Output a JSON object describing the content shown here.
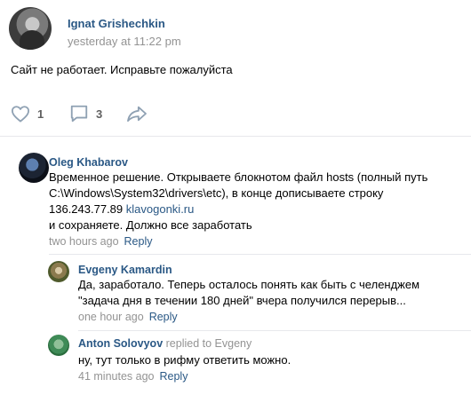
{
  "post": {
    "author": "Ignat Grishechkin",
    "time": "yesterday at 11:22 pm",
    "text": "Сайт не работает. Исправьте пожалуйста",
    "likes": "1",
    "comments": "3"
  },
  "comments": [
    {
      "author": "Oleg Khabarov",
      "lines": [
        "Временное решение. Открываете блокнотом файл hosts (полный путь",
        "C:\\Windows\\System32\\drivers\\etc), в конце дописываете строку"
      ],
      "ip": "136.243.77.89",
      "link": "klavogonki.ru",
      "last_line": "и сохраняете. Должно все заработать",
      "time": "two hours ago",
      "reply_label": "Reply"
    },
    {
      "author": "Evgeny Kamardin",
      "lines": [
        "Да, заработало. Теперь осталось понять как быть с челенджем",
        "\"задача дня в течении 180 дней\" вчера получился перерыв..."
      ],
      "time": "one hour ago",
      "reply_label": "Reply"
    },
    {
      "author": "Anton Solovyov",
      "replied_to": "replied to Evgeny",
      "lines": [
        "ну, тут только в рифму ответить можно."
      ],
      "time": "41 minutes ago",
      "reply_label": "Reply"
    }
  ],
  "icons": {
    "like": "heart-icon",
    "comment": "comment-icon",
    "share": "share-icon"
  },
  "colors": {
    "link": "#2a5885",
    "muted": "#939393",
    "icon": "#8fa1b3"
  }
}
